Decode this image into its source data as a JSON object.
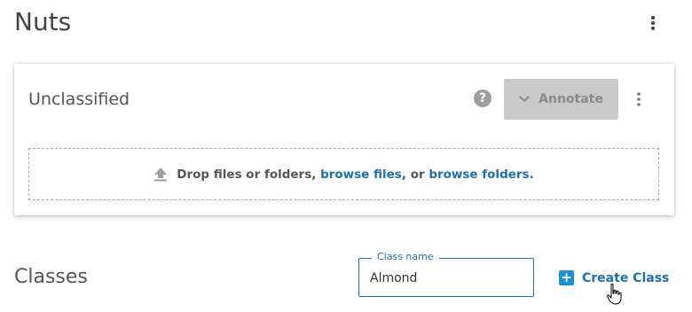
{
  "page": {
    "title": "Nuts",
    "more_icon": "more-vert-icon"
  },
  "card": {
    "title": "Unclassified",
    "help_icon": "help-icon",
    "help_glyph": "?",
    "annotate": {
      "label": "Annotate",
      "icon": "chevron-down-icon"
    },
    "more_icon": "more-vert-icon",
    "dropzone": {
      "icon": "upload-icon",
      "text_prefix": "Drop files or folders, ",
      "link_files": "browse files",
      "text_middle": ", or ",
      "link_folders": "browse folders."
    }
  },
  "classes": {
    "title": "Classes",
    "field": {
      "label": "Class name",
      "value": "Almond"
    },
    "create_button": {
      "icon": "plus-icon",
      "label": "Create Class"
    }
  },
  "colors": {
    "accent": "#1f6fa8",
    "plus_box": "#1f8fd6",
    "disabled_button": "#c9c9c9"
  }
}
